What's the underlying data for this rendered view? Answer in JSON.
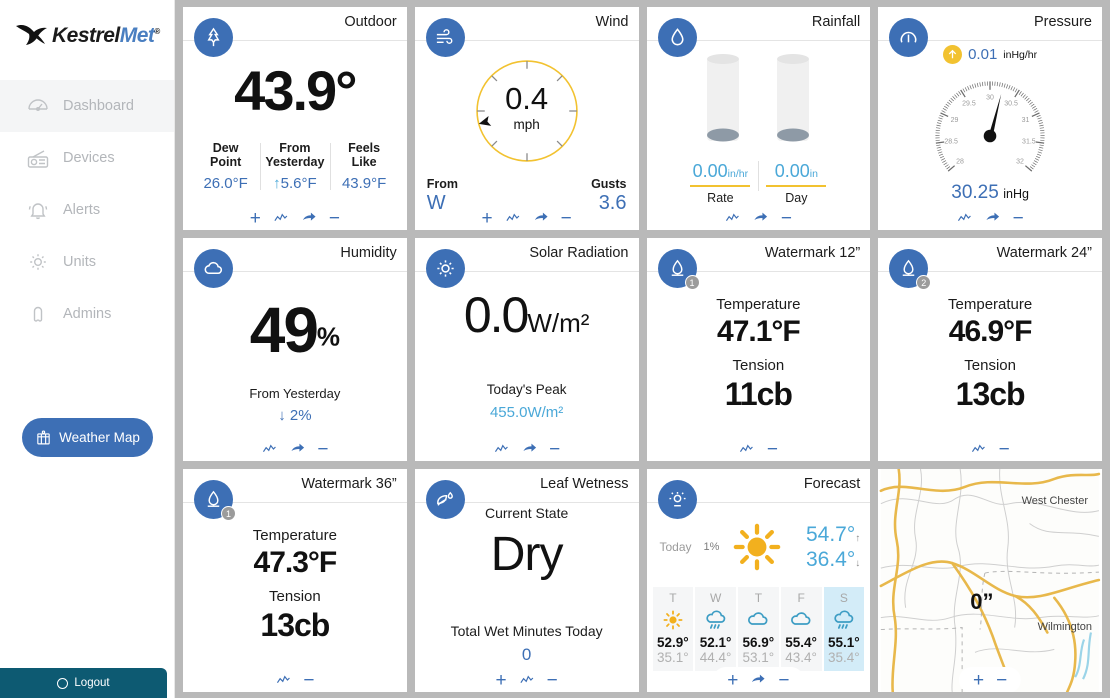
{
  "brand": {
    "name_first": "Kestrel",
    "name_second": "Met",
    "tm": "®"
  },
  "sidebar": {
    "items": [
      {
        "label": "Dashboard",
        "icon": "gauge-icon",
        "active": true
      },
      {
        "label": "Devices",
        "icon": "radio-icon",
        "active": false
      },
      {
        "label": "Alerts",
        "icon": "bell-icon",
        "active": false
      },
      {
        "label": "Units",
        "icon": "gear-icon",
        "active": false
      },
      {
        "label": "Admins",
        "icon": "person-icon",
        "active": false
      }
    ],
    "weather_map_button": "Weather Map",
    "logout": "Logout"
  },
  "cards": {
    "outdoor": {
      "title": "Outdoor",
      "temperature": "43.9°",
      "stats": [
        {
          "label_line1": "Dew",
          "label_line2": "Point",
          "value": "26.0°F",
          "arrow": ""
        },
        {
          "label_line1": "From",
          "label_line2": "Yesterday",
          "value": "5.6°F",
          "arrow": "↑"
        },
        {
          "label_line1": "Feels",
          "label_line2": "Like",
          "value": "43.9°F",
          "arrow": ""
        }
      ]
    },
    "wind": {
      "title": "Wind",
      "speed": "0.4",
      "unit": "mph",
      "from_label": "From",
      "from_value": "W",
      "gusts_label": "Gusts",
      "gusts_value": "3.6",
      "direction_degrees": 255
    },
    "rainfall": {
      "title": "Rainfall",
      "rate_value": "0.00",
      "rate_unit": "in/hr",
      "rate_label": "Rate",
      "day_value": "0.00",
      "day_unit": "in",
      "day_label": "Day"
    },
    "pressure": {
      "title": "Pressure",
      "trend_value": "0.01",
      "trend_unit": "inHg/hr",
      "trend_direction": "up",
      "reading": "30.25",
      "reading_unit": "inHg",
      "gauge_ticks": [
        "28",
        "28.5",
        "29",
        "29.5",
        "30",
        "30.5",
        "31",
        "31.5",
        "32"
      ],
      "gauge_min": 28,
      "gauge_max": 32
    },
    "humidity": {
      "title": "Humidity",
      "value": "49",
      "unit": "%",
      "sub_label": "From Yesterday",
      "delta": "2%",
      "delta_arrow": "↓"
    },
    "solar": {
      "title": "Solar Radiation",
      "value": "0.0",
      "unit": "W/m²",
      "peak_label": "Today's Peak",
      "peak_value": "455.0W/m²"
    },
    "watermark12": {
      "title": "Watermark 12”",
      "badge": "1",
      "temp_label": "Temperature",
      "temp_value": "47.1°F",
      "tension_label": "Tension",
      "tension_value": "11cb"
    },
    "watermark24": {
      "title": "Watermark 24”",
      "badge": "2",
      "temp_label": "Temperature",
      "temp_value": "46.9°F",
      "tension_label": "Tension",
      "tension_value": "13cb"
    },
    "watermark36": {
      "title": "Watermark 36”",
      "badge": "1",
      "temp_label": "Temperature",
      "temp_value": "47.3°F",
      "tension_label": "Tension",
      "tension_value": "13cb"
    },
    "leaf": {
      "title": "Leaf Wetness",
      "state_label": "Current State",
      "state_value": "Dry",
      "minutes_label": "Total Wet Minutes Today",
      "minutes_value": "0"
    },
    "forecast": {
      "title": "Forecast",
      "today_label": "Today",
      "today_pop": "1%",
      "today_icon": "sun-icon",
      "today_high": "54.7°",
      "today_low": "36.4°",
      "high_arrow": "↑",
      "low_arrow": "↓",
      "days": [
        {
          "label": "T",
          "icon": "sun-icon",
          "high": "52.9°",
          "low": "35.1°",
          "highlighted": false
        },
        {
          "label": "W",
          "icon": "rain-icon",
          "high": "52.1°",
          "low": "44.4°",
          "highlighted": false
        },
        {
          "label": "T",
          "icon": "cloud-icon",
          "high": "56.9°",
          "low": "53.1°",
          "highlighted": false
        },
        {
          "label": "F",
          "icon": "cloud-icon",
          "high": "55.4°",
          "low": "43.4°",
          "highlighted": false
        },
        {
          "label": "S",
          "icon": "rain-icon",
          "high": "55.1°",
          "low": "35.4°",
          "highlighted": true
        }
      ]
    },
    "map": {
      "labels": [
        "West Chester",
        "Wilmington"
      ],
      "snow_value": "0”",
      "zoom_in": "+",
      "zoom_out": "−"
    }
  },
  "colors": {
    "accent_blue": "#3d6fb5",
    "light_blue": "#4aa8d8",
    "yellow": "#f2c230",
    "logout_teal": "#0d5a72",
    "grid_bg": "#b9b9b9"
  }
}
